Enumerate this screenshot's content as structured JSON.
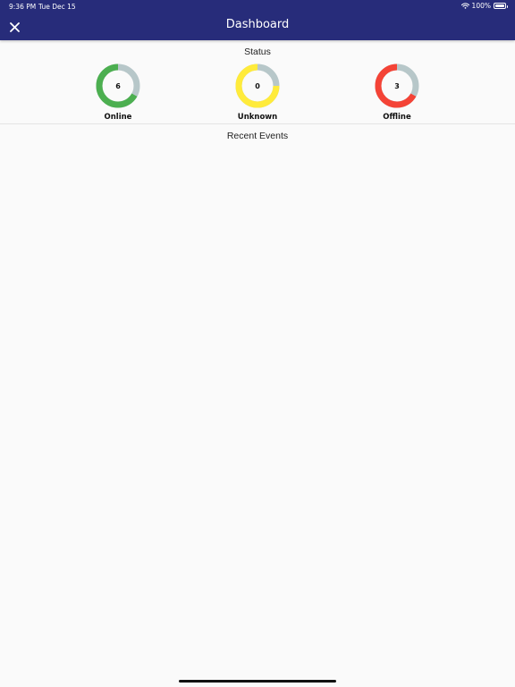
{
  "statusbar": {
    "time": "9:36 PM",
    "date": "Tue Dec 15",
    "battery": "100%"
  },
  "appbar": {
    "title": "Dashboard",
    "close_icon": "close-icon",
    "background": "#272c7a"
  },
  "status": {
    "title": "Status",
    "track_color": "#b7c7c9",
    "gauges": [
      {
        "label": "Online",
        "count": "6",
        "color": "#4caf50",
        "fraction": 0.67
      },
      {
        "label": "Unknown",
        "count": "0",
        "color": "#ffeb3b",
        "fraction": 0.75
      },
      {
        "label": "Offline",
        "count": "3",
        "color": "#f44336",
        "fraction": 0.67
      }
    ]
  },
  "events": {
    "title": "Recent Events"
  }
}
